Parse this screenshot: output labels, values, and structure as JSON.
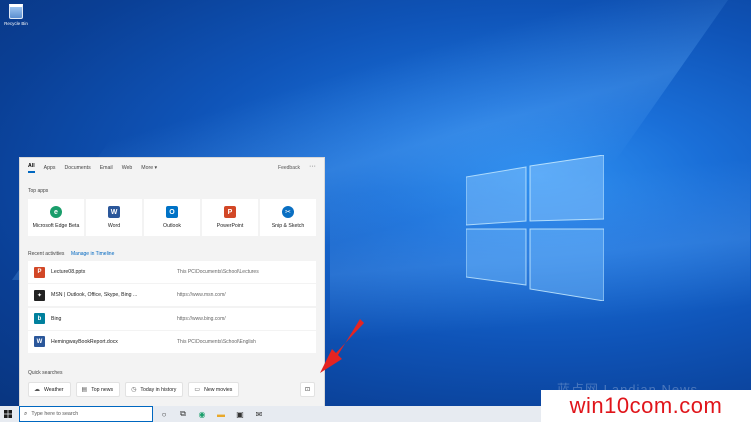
{
  "desktop": {
    "recycle_bin_label": "Recycle Bin"
  },
  "search_panel": {
    "tabs": [
      {
        "label": "All",
        "active": true
      },
      {
        "label": "Apps"
      },
      {
        "label": "Documents"
      },
      {
        "label": "Email"
      },
      {
        "label": "Web"
      },
      {
        "label": "More ▾"
      }
    ],
    "feedback": "Feedback",
    "more_options": "···",
    "top_apps_title": "Top apps",
    "top_apps": [
      {
        "name": "Microsoft Edge Beta",
        "icon": "edge-icon",
        "color": "#1a9e6b"
      },
      {
        "name": "Word",
        "icon": "word-icon",
        "color": "#2b579a"
      },
      {
        "name": "Outlook",
        "icon": "outlook-icon",
        "color": "#0072c6"
      },
      {
        "name": "PowerPoint",
        "icon": "powerpoint-icon",
        "color": "#d24726"
      },
      {
        "name": "Snip & Sketch",
        "icon": "snip-icon",
        "color": "#0a6fc2"
      }
    ],
    "recent_title": "Recent activities",
    "manage_timeline": "Manage in Timeline",
    "recent": [
      {
        "name": "Lecture08.pptx",
        "path": "This PC\\Documents\\School\\Lectures",
        "icon": "powerpoint-icon",
        "color": "#d24726"
      },
      {
        "name": "MSN | Outlook, Office, Skype, Bing ...",
        "path": "https://www.msn.com/",
        "icon": "msn-icon",
        "color": "#222222"
      },
      {
        "name": "Bing",
        "path": "https://www.bing.com/",
        "icon": "bing-icon",
        "color": "#00809d"
      },
      {
        "name": "HemingwayBookReport.docx",
        "path": "This PC\\Documents\\School\\English",
        "icon": "word-icon",
        "color": "#2b579a"
      }
    ],
    "quick_title": "Quick searches",
    "quick": [
      {
        "label": "Weather",
        "icon": "cloud-icon"
      },
      {
        "label": "Top news",
        "icon": "news-icon"
      },
      {
        "label": "Today in history",
        "icon": "clock-icon"
      },
      {
        "label": "New movies",
        "icon": "film-icon"
      }
    ],
    "lens_icon": "screenshot-search-icon"
  },
  "taskbar": {
    "search_placeholder": "Type here to search"
  },
  "watermark": {
    "cn": "蓝点网 Landian.News",
    "text": "win10com.com"
  },
  "colors": {
    "accent": "#0067c0",
    "arrow": "#e52421"
  }
}
